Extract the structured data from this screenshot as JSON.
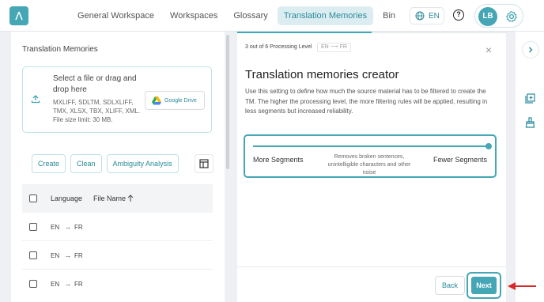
{
  "nav": {
    "items": [
      {
        "label": "General Workspace",
        "active": false
      },
      {
        "label": "Workspaces",
        "active": false
      },
      {
        "label": "Glossary",
        "active": false
      },
      {
        "label": "Translation Memories",
        "active": true
      },
      {
        "label": "Bin",
        "active": false
      }
    ],
    "language": "EN",
    "help": "?",
    "user_initials": "LB"
  },
  "left_panel": {
    "title": "Translation Memories",
    "dropzone": {
      "main": "Select a file or drag and drop here",
      "formats": "MXLIFF, SDLTM, SDLXLIFF, TMX, XLSX, TBX, XLIFF, XML.",
      "limit": "File size limit: 30 MB.",
      "drive_button": "Google Drive"
    },
    "buttons": {
      "create": "Create",
      "clean": "Clean",
      "ambiguity": "Ambiguity Analysis"
    },
    "table": {
      "col_language": "Language",
      "col_filename": "File Name",
      "rows": [
        {
          "src": "EN",
          "tgt": "FR"
        },
        {
          "src": "EN",
          "tgt": "FR"
        },
        {
          "src": "EN",
          "tgt": "FR"
        }
      ]
    }
  },
  "modal": {
    "step": "3 out of 6 Processing Level",
    "pair": "EN ⟶ FR",
    "close": "×",
    "title": "Translation memories creator",
    "description": "Use this setting to define how much the source material has to be filtered to create the TM. The higher the processing level, the more filtering rules will be applied, resulting in less segments but increased reliability.",
    "slider": {
      "left": "More Segments",
      "right": "Fewer Segments",
      "middle": "Removes broken sentences, unintelligible characters and other noise",
      "value": 1.0
    },
    "progress": 0.5,
    "back": "Back",
    "next": "Next"
  },
  "colors": {
    "accent": "#45a6b5",
    "annotation": "#d62828"
  }
}
